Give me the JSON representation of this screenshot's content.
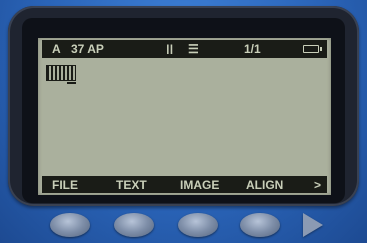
{
  "status": {
    "mode": "A",
    "size": "37 AP",
    "justify_glyph": "ǀǀ",
    "align_glyph": "☰",
    "page": "1/1",
    "battery_icon": "battery-icon"
  },
  "softkeys": {
    "file": "FILE",
    "text": "TEXT",
    "image": "IMAGE",
    "align": "ALIGN",
    "more": ">"
  },
  "colors": {
    "device": "#2d6bc3",
    "lcd": "#aab09d",
    "lcd_ink": "#1a1c17"
  }
}
